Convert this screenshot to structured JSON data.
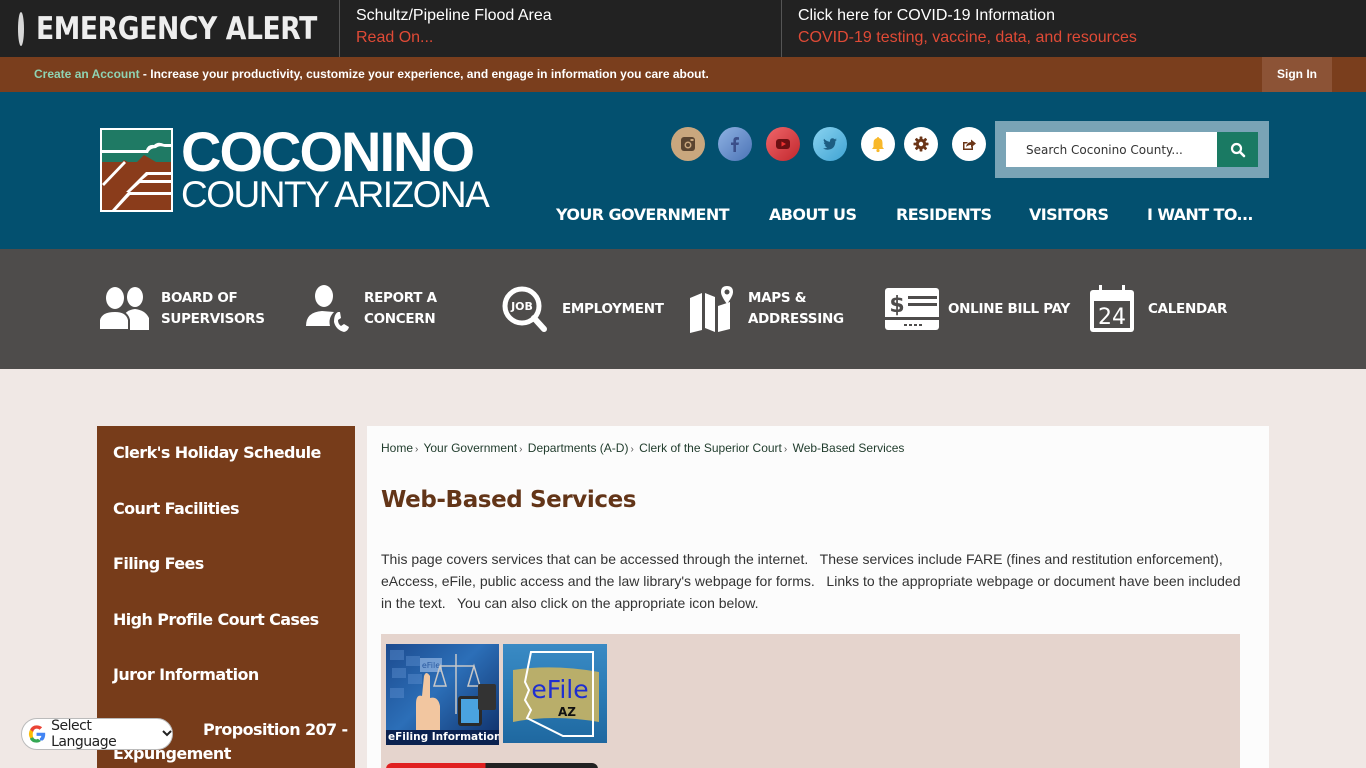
{
  "alert": {
    "title": "EMERGENCY ALERT",
    "items": [
      {
        "headline": "Schultz/Pipeline Flood Area",
        "link": "Read On..."
      },
      {
        "headline": "Click here for COVID-19 Information",
        "link": "COVID-19 testing, vaccine, data, and resources"
      }
    ]
  },
  "account_bar": {
    "create_link": "Create an Account",
    "message": " - Increase your productivity, customize your experience, and engage in information you care about.",
    "sign_in": "Sign In"
  },
  "header": {
    "logo_line1": "COCONINO",
    "logo_line2": "COUNTY ARIZONA",
    "social": [
      {
        "icon": "instagram-icon",
        "color": "#c9a77e"
      },
      {
        "icon": "facebook-icon",
        "color": "#6f97d2"
      },
      {
        "icon": "youtube-icon",
        "color": "#d9363a"
      },
      {
        "icon": "twitter-icon",
        "color": "#5fb9df"
      },
      {
        "icon": "bell-icon",
        "color": "#ffffff"
      },
      {
        "icon": "gear-icon",
        "color": "#ffffff"
      },
      {
        "icon": "share-icon",
        "color": "#ffffff"
      }
    ],
    "search_placeholder": "Search Coconino County..."
  },
  "main_nav": [
    "YOUR GOVERNMENT",
    "ABOUT US",
    "RESIDENTS",
    "VISITORS",
    "I WANT TO..."
  ],
  "quick_links": [
    {
      "line1": "BOARD OF",
      "line2": "SUPERVISORS",
      "icon": "people-icon"
    },
    {
      "line1": "REPORT A",
      "line2": "CONCERN",
      "icon": "person-phone-icon"
    },
    {
      "line1": "EMPLOYMENT",
      "line2": "",
      "icon": "job-search-icon"
    },
    {
      "line1": "MAPS &",
      "line2": "ADDRESSING",
      "icon": "map-pin-icon"
    },
    {
      "line1": "ONLINE BILL PAY",
      "line2": "",
      "icon": "bill-card-icon"
    },
    {
      "line1": "CALENDAR",
      "line2": "",
      "icon": "calendar-icon"
    }
  ],
  "calendar_day": "24",
  "job_text": "JOB",
  "sidebar": [
    "Clerk's Holiday Schedule",
    "Court Facilities",
    "Filing Fees",
    "High Profile Court Cases",
    "Juror Information",
    "Proposition 207 -",
    "Expungement"
  ],
  "breadcrumb": [
    "Home",
    "Your Government",
    "Departments (A-D)",
    "Clerk of the Superior Court",
    "Web-Based Services"
  ],
  "breadcrumb_sep": "›",
  "page_title": "Web-Based Services",
  "intro": "This page covers services that can be accessed through the internet.   These services include FARE (fines and restitution enforcement), eAccess, eFile, public access and the law library's webpage for forms.   Links to the appropriate webpage or document have been included in the text.   You can also click on the appropriate icon below.",
  "tiles": {
    "efiling_caption": "eFiling  Information",
    "efile_small": "eFile",
    "efile_az_main": "eFile",
    "efile_az_sub": "AZ"
  },
  "language": {
    "label": "Select Language",
    "chevron": "⌄"
  }
}
